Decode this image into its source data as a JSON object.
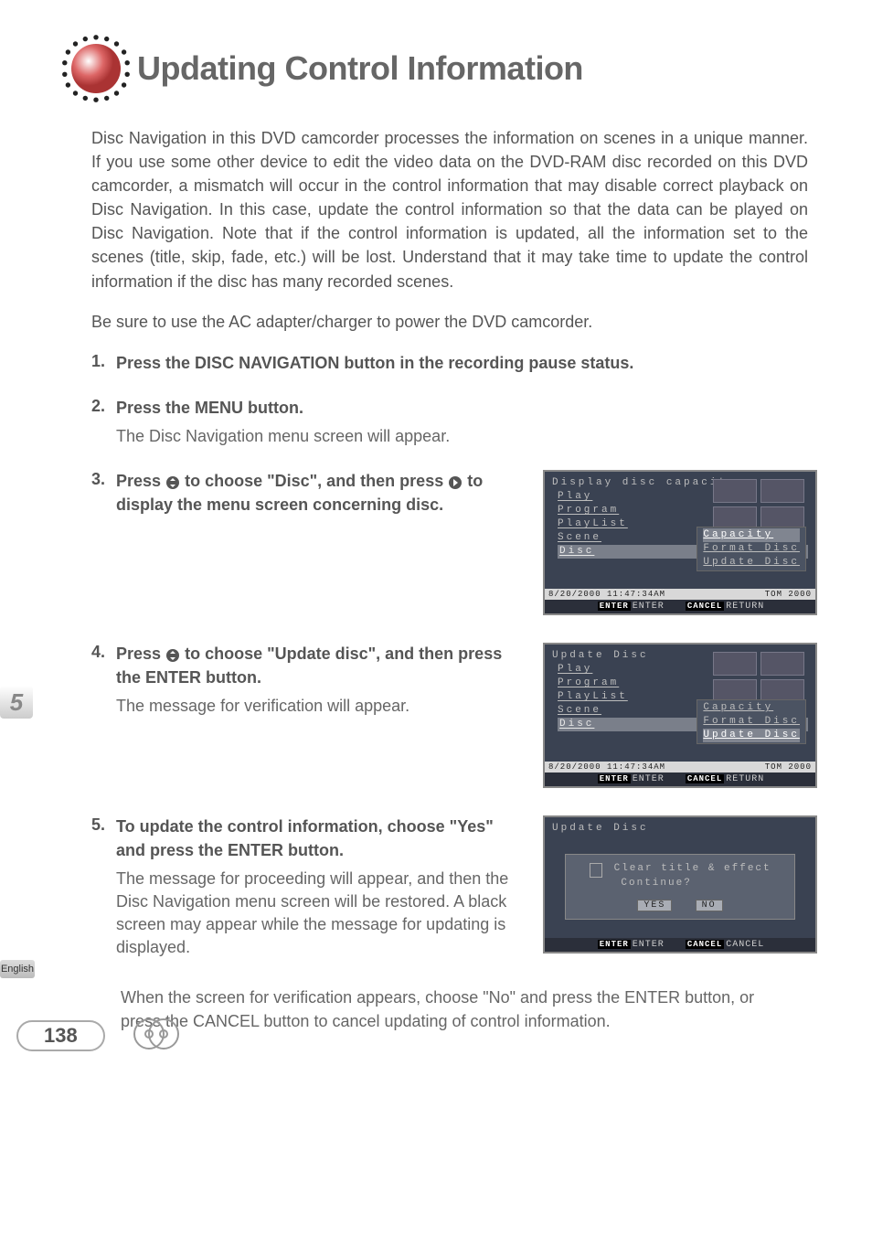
{
  "title": "Updating Control Information",
  "intro_p1": "Disc Navigation in this DVD camcorder processes the information on scenes in a unique manner. If you use some other device to edit the video data on the DVD-RAM disc recorded on this DVD camcorder, a mismatch will occur in the control information that may disable correct playback on Disc Navigation. In this case, update the control information so that the data can be played on Disc Navigation. Note that if the control information is updated, all the information set to the scenes (title, skip, fade, etc.) will be lost. Understand that it may take time to update the control information if the disc has many recorded scenes.",
  "intro_p2": "Be sure to use the AC adapter/charger to power the DVD camcorder.",
  "steps": {
    "s1": {
      "num": "1.",
      "head": "Press the DISC NAVIGATION button in the recording pause status."
    },
    "s2": {
      "num": "2.",
      "head": "Press the MENU button.",
      "desc": "The Disc Navigation menu screen will appear."
    },
    "s3": {
      "num": "3.",
      "head_a": "Press ",
      "head_b": " to choose \"Disc\", and then press ",
      "head_c": " to display the menu screen concerning disc."
    },
    "s4": {
      "num": "4.",
      "head_a": "Press ",
      "head_b": " to choose \"Update disc\", and then press the ENTER button.",
      "desc": "The message for verification will appear."
    },
    "s5": {
      "num": "5.",
      "head": "To update the control information, choose \"Yes\" and press the ENTER button.",
      "desc1": "The message for proceeding will appear, and then the Disc Navigation menu screen will be restored. A black screen may appear while the message for updating is displayed.",
      "desc2": "When the screen for verification appears, choose \"No\" and press the ENTER button, or press the CANCEL button to cancel updating of control information."
    }
  },
  "osd1": {
    "title": "Display disc capacity",
    "menu": [
      "Play",
      "Program",
      "PlayList",
      "Scene",
      "Disc"
    ],
    "submenu": [
      "Capacity",
      "Format Disc",
      "Update Disc"
    ],
    "status_left": "8/20/2000 11:47:34AM",
    "status_right": "TOM 2000",
    "footer_enter_label": "ENTER",
    "footer_enter": "ENTER",
    "footer_cancel_label": "CANCEL",
    "footer_cancel": "RETURN"
  },
  "osd2": {
    "title": "Update Disc",
    "menu": [
      "Play",
      "Program",
      "PlayList",
      "Scene",
      "Disc"
    ],
    "submenu": [
      "Capacity",
      "Format Disc",
      "Update Disc"
    ],
    "status_left": "8/20/2000 11:47:34AM",
    "status_right": "TOM 2000",
    "footer_enter_label": "ENTER",
    "footer_enter": "ENTER",
    "footer_cancel_label": "CANCEL",
    "footer_cancel": "RETURN"
  },
  "osd3": {
    "title": "Update Disc",
    "dialog_line1": "Clear title & effect",
    "dialog_line2": "Continue?",
    "yes": "YES",
    "no": "NO",
    "footer_enter_label": "ENTER",
    "footer_enter": "ENTER",
    "footer_cancel_label": "CANCEL",
    "footer_cancel": "CANCEL"
  },
  "side_number": "5",
  "side_lang": "English",
  "page_number": "138"
}
